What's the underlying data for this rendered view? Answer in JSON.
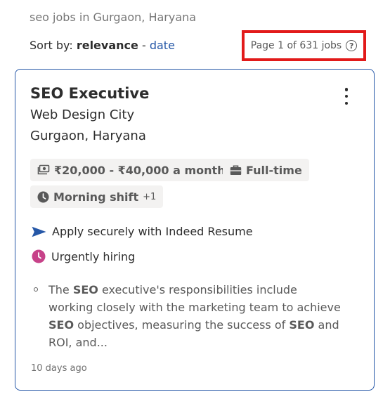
{
  "search": {
    "title": "seo jobs in Gurgaon, Haryana"
  },
  "sort": {
    "label": "Sort by:",
    "active": "relevance",
    "separator": "-",
    "alternative": "date"
  },
  "pagination": {
    "text": "Page 1 of 631 jobs",
    "help_icon": "question-circle-icon"
  },
  "job": {
    "title": "SEO Executive",
    "company": "Web Design City",
    "location": "Gurgaon, Haryana",
    "salary": "₹20,000 - ₹40,000 a month",
    "job_type": "Full-time",
    "shift": "Morning shift",
    "shift_extra": "+1",
    "apply_text": "Apply securely with Indeed Resume",
    "urgent_text": "Urgently hiring",
    "snippet": {
      "p1": "The ",
      "k1": "SEO",
      "p2": " executive's responsibilities include working closely with the marketing team to achieve ",
      "k2": "SEO",
      "p3": " objectives, measuring the success of ",
      "k3": "SEO",
      "p4": " and ROI, and..."
    },
    "posted": "10 days ago"
  },
  "colors": {
    "link": "#2557a7",
    "highlight_border": "#e21a1a",
    "urgent_icon": "#c74289",
    "card_border": "#2557a7"
  }
}
